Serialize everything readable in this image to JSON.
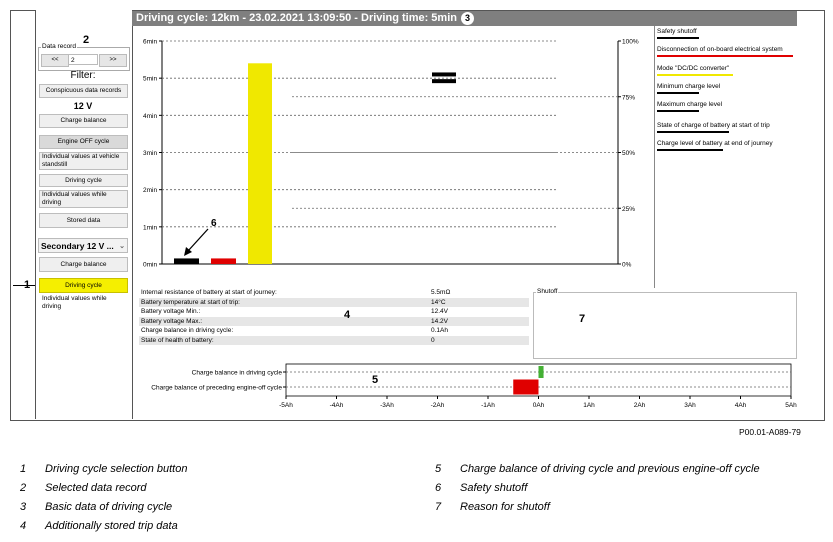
{
  "callouts": {
    "c1": "1",
    "c2": "2",
    "c3": "3",
    "c4": "4",
    "c5": "5",
    "c6": "6",
    "c7": "7"
  },
  "sidebar": {
    "data_record_label": "Data record",
    "prev_label": "<<",
    "record_value": "2",
    "next_label": ">>",
    "filter_label": "Filter:",
    "conspicuous_label": "Conspicuous data records",
    "voltage_label": "12 V",
    "charge_balance_label": "Charge balance",
    "engine_off_label": "Engine OFF cycle",
    "individual_standstill_label": "Individual values at vehicle standstill",
    "driving_cycle_label": "Driving cycle",
    "individual_driving_label": "Individual values while driving",
    "stored_data_label": "Stored data",
    "secondary_select": "Secondary 12 V ...",
    "sec_charge_balance_label": "Charge balance",
    "sec_driving_cycle_label": "Driving cycle",
    "sec_individual_driving_label": "Individual values while driving"
  },
  "header": {
    "title": "Driving cycle: 12km - 23.02.2021 13:09:50 - Driving time: 5min"
  },
  "legend": [
    {
      "label": "Safety shutoff",
      "color": "#000000"
    },
    {
      "label": "Disconnection of on-board electrical system",
      "color": "#e00000"
    },
    {
      "label": "Mode \"DC/DC converter\"",
      "color": "#f0e800"
    },
    {
      "label": "Minimum charge level",
      "color": "#000000"
    },
    {
      "label": "Maximum charge level",
      "color": "#000000"
    },
    {
      "label": "State of charge of battery at start of trip",
      "color": "#000000"
    },
    {
      "label": "Charge level of battery at end of journey",
      "color": "#000000"
    }
  ],
  "chart_data": [
    {
      "type": "bar",
      "left_axis_ticks": [
        "6min",
        "5min",
        "4min",
        "3min",
        "2min",
        "1min",
        "0min"
      ],
      "right_axis_ticks": [
        "100%",
        "75%",
        "50%",
        "25%",
        "0%"
      ],
      "bars": [
        {
          "value_min": 0.15,
          "color": "#000000"
        },
        {
          "value_min": 0.15,
          "color": "#e00000"
        },
        {
          "value_min": 5.4,
          "color": "#f0e800"
        }
      ],
      "markers_percent": [
        85,
        82
      ],
      "ylim_min": [
        0,
        6
      ],
      "ylim_percent": [
        0,
        100
      ]
    },
    {
      "type": "bar",
      "orientation": "horizontal",
      "categories": [
        "Charge balance in driving cycle",
        "Charge balance of preceding engine-off cycle"
      ],
      "values": [
        0.1,
        -0.5
      ],
      "colors": [
        "#44b034",
        "#e00000"
      ],
      "x_ticks": [
        "-5Ah",
        "-4Ah",
        "-3Ah",
        "-2Ah",
        "-1Ah",
        "0Ah",
        "1Ah",
        "2Ah",
        "3Ah",
        "4Ah",
        "5Ah"
      ],
      "xlim": [
        -5,
        5
      ]
    }
  ],
  "info_rows": [
    {
      "label": "Internal resistance of battery at start of journey:",
      "value": "5.5mΩ"
    },
    {
      "label": "Battery temperature at start of trip:",
      "value": "14°C"
    },
    {
      "label": "Battery voltage Min.:",
      "value": "12.4V"
    },
    {
      "label": "Battery voltage Max.:",
      "value": "14.2V"
    },
    {
      "label": "Charge balance in driving cycle:",
      "value": "0.1Ah"
    },
    {
      "label": "State of health of battery:",
      "value": "0"
    }
  ],
  "shutoff_label": "Shutoff",
  "figure_id": "P00.01-A089-79",
  "captions": [
    {
      "num": "1",
      "text": "Driving cycle selection button"
    },
    {
      "num": "2",
      "text": "Selected data record"
    },
    {
      "num": "3",
      "text": "Basic data of driving cycle"
    },
    {
      "num": "4",
      "text": "Additionally stored trip data"
    },
    {
      "num": "5",
      "text": "Charge balance of driving cycle and previous engine-off cycle"
    },
    {
      "num": "6",
      "text": "Safety shutoff"
    },
    {
      "num": "7",
      "text": "Reason for shutoff"
    }
  ]
}
